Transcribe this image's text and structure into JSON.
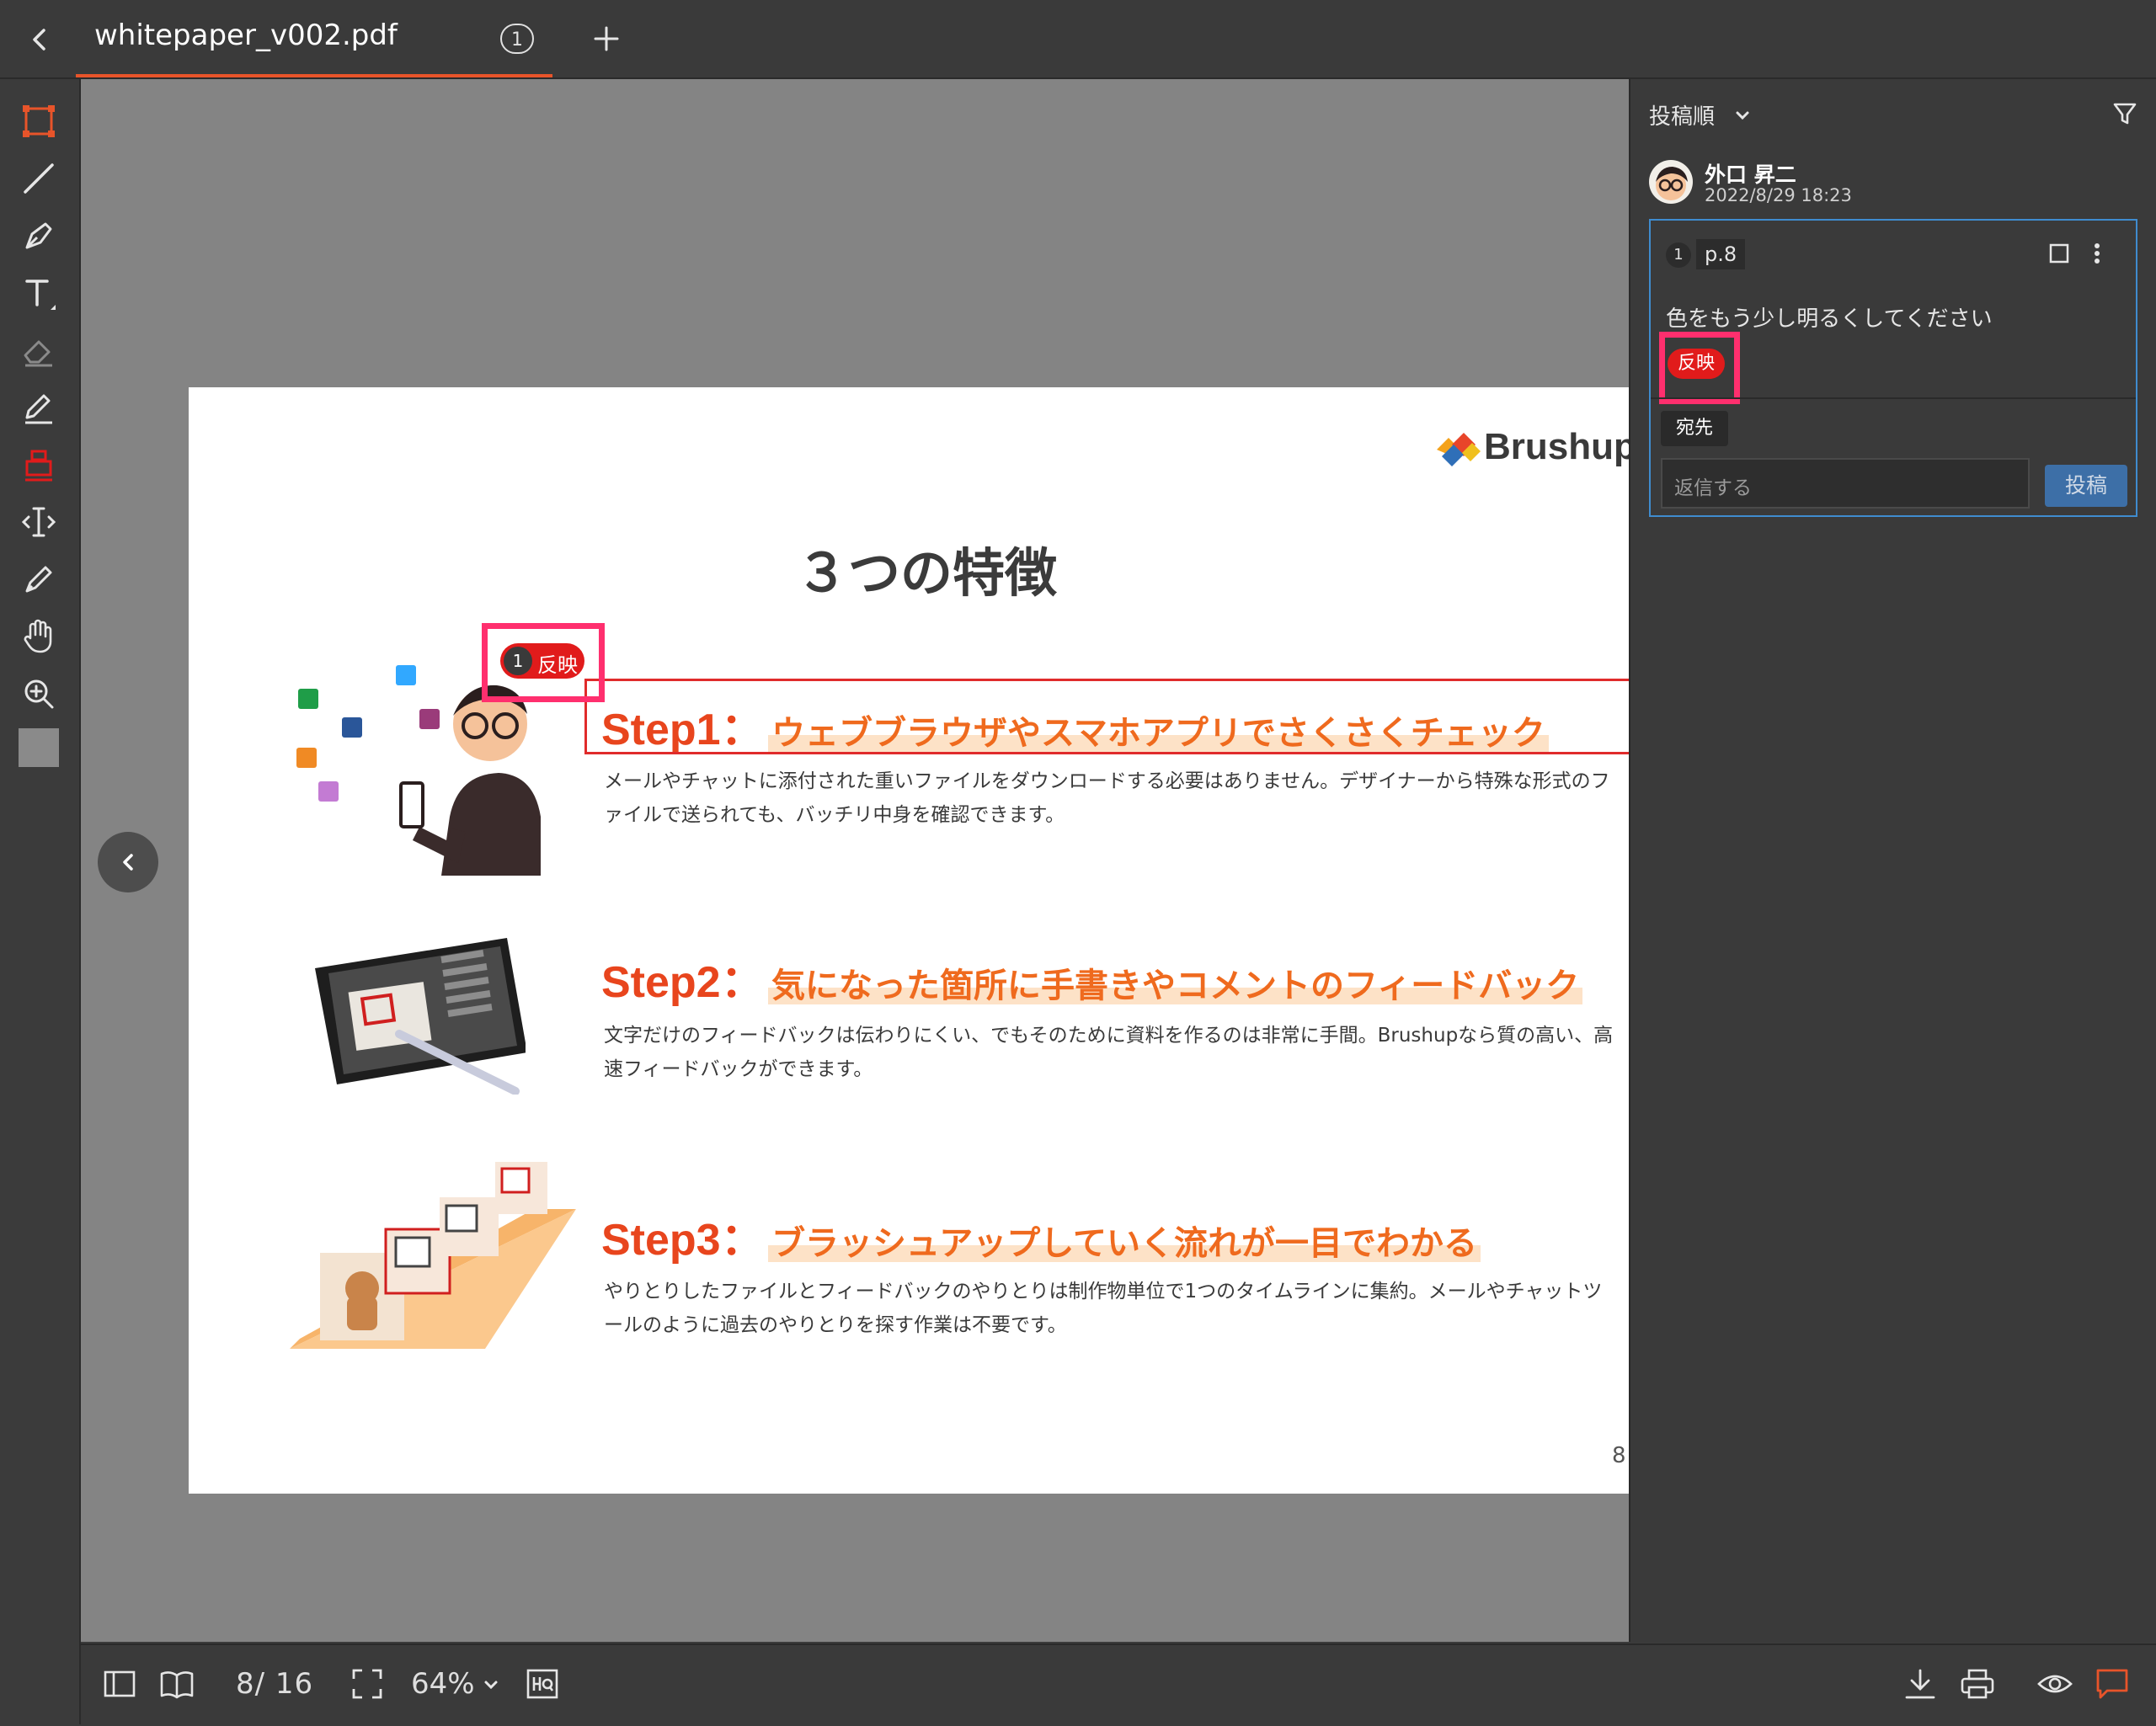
{
  "tab": {
    "title": "whitepaper_v002.pdf",
    "badge": "1"
  },
  "panel": {
    "sort_label": "投稿順",
    "author": "外口 昇二",
    "timestamp": "2022/8/29 18:23",
    "comment_number": "1",
    "comment_page": "p.8",
    "comment_text": "色をもう少し明るくしてください",
    "status_tag": "反映",
    "recipient_label": "宛先",
    "reply_placeholder": "返信する",
    "post_label": "投稿"
  },
  "document": {
    "logo_text": "Brushup",
    "title": "３つの特徴",
    "annotation_number": "1",
    "annotation_label": "反映",
    "steps": [
      {
        "num": "Step1：",
        "heading": "ウェブブラウザやスマホアプリでさくさくチェック",
        "desc": "メールやチャットに添付された重いファイルをダウンロードする必要はありません。デザイナーから特殊な形式のファイルで送られても、バッチリ中身を確認できます。"
      },
      {
        "num": "Step2：",
        "heading": "気になった箇所に手書きやコメントのフィードバック",
        "desc": "文字だけのフィードバックは伝わりにくい、でもそのために資料を作るのは非常に手間。Brushupなら質の高い、高速フィードバックができます。"
      },
      {
        "num": "Step3：",
        "heading": "ブラッシュアップしていく流れが一目でわかる",
        "desc": "やりとりしたファイルとフィードバックのやりとりは制作物単位で1つのタイムラインに集約。メールやチャットツールのように過去のやりとりを探す作業は不要です。"
      }
    ],
    "page_number": "8"
  },
  "bottom_bar": {
    "page_indicator": "8/ 16",
    "zoom": "64%"
  },
  "icons": [
    "back-icon",
    "add-tab-icon",
    "rectangle-tool-icon",
    "line-tool-icon",
    "pen-tool-icon",
    "text-tool-icon",
    "eraser-icon",
    "pencil-icon",
    "stamp-icon",
    "text-cursor-icon",
    "marker-icon",
    "hand-icon",
    "zoom-in-icon",
    "color-swatch-icon",
    "filter-icon",
    "chevron-down-icon",
    "checkbox-icon",
    "more-icon",
    "prev-page-icon",
    "next-page-icon",
    "sidebar-icon",
    "book-icon",
    "fit-screen-icon",
    "hq-icon",
    "download-icon",
    "print-icon",
    "eye-icon",
    "comment-icon"
  ],
  "colors": {
    "accent": "#e8542a",
    "annotation_red": "#e11b1b",
    "highlight_pink": "#ff2f6e",
    "link_blue": "#3f8ccf",
    "post_button": "#3d6fa7"
  }
}
